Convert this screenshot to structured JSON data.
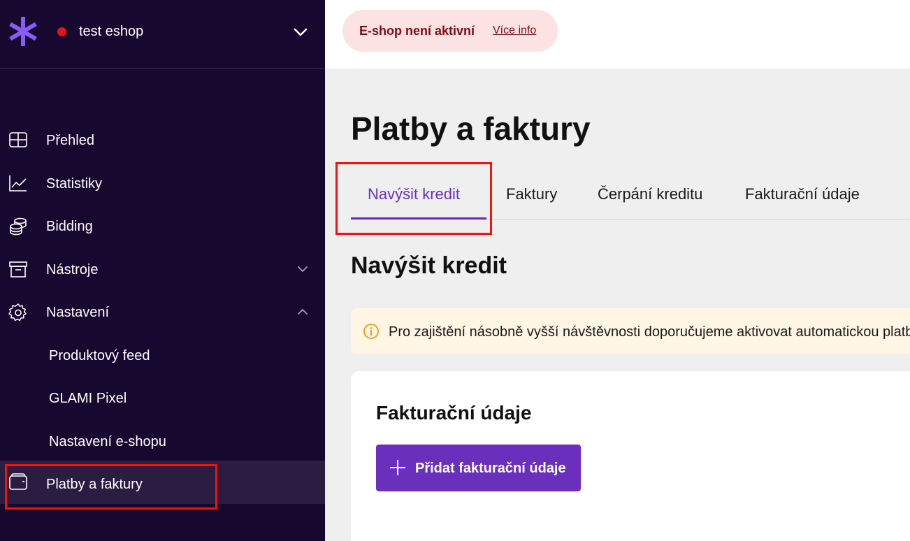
{
  "colors": {
    "sidebar_bg": "#170830",
    "accent": "#6a2fbd",
    "logo": "#8a5cf6",
    "status_dot": "#e8101a",
    "alert_bg": "#fde2e4",
    "alert_text": "#7b0c16",
    "info_bg": "#fff6e5",
    "info_icon": "#f0a020",
    "highlight": "#f0140c"
  },
  "shop": {
    "name": "test eshop",
    "logo_icon": "asterisk-icon",
    "status_icon": "status-dot-icon",
    "dropdown_icon": "chevron-down-icon"
  },
  "sidebar": {
    "items": [
      {
        "label": "Přehled",
        "icon": "grid-icon"
      },
      {
        "label": "Statistiky",
        "icon": "line-chart-icon"
      },
      {
        "label": "Bidding",
        "icon": "coins-icon"
      },
      {
        "label": "Nástroje",
        "icon": "archive-box-icon",
        "expand_icon": "chevron-down-icon"
      },
      {
        "label": "Nastavení",
        "icon": "gear-icon",
        "expand_icon": "chevron-up-icon"
      }
    ],
    "subitems": [
      {
        "label": "Produktový feed"
      },
      {
        "label": "GLAMI Pixel"
      },
      {
        "label": "Nastavení e-shopu"
      }
    ],
    "active_item": {
      "label": "Platby a faktury",
      "icon": "wallet-icon"
    }
  },
  "alert": {
    "text": "E-shop není aktivní",
    "link": "Více info"
  },
  "main": {
    "title": "Platby a faktury",
    "tabs": [
      {
        "label": "Navýšit kredit",
        "active": true
      },
      {
        "label": "Faktury"
      },
      {
        "label": "Čerpání kreditu"
      },
      {
        "label": "Fakturační údaje"
      }
    ],
    "section_title": "Navýšit kredit",
    "info_banner": {
      "icon": "info-circle-icon",
      "text": "Pro zajištění násobně vyšší návštěvnosti doporučujeme aktivovat automatickou platbu"
    },
    "card": {
      "title": "Fakturační údaje",
      "button_label": "Přidat fakturační údaje",
      "button_icon": "plus-icon"
    }
  }
}
